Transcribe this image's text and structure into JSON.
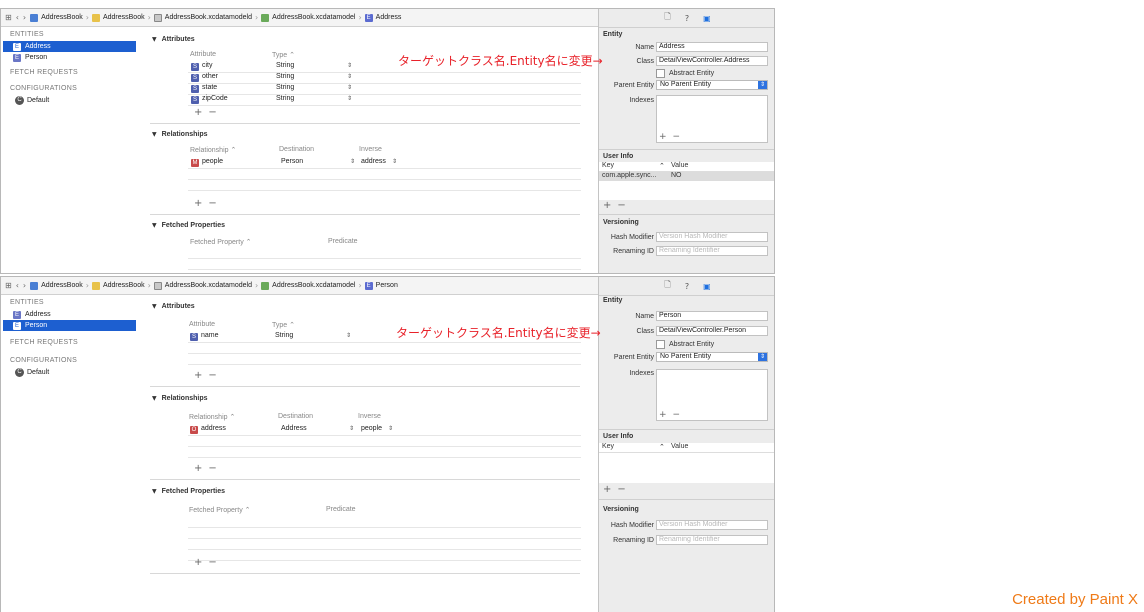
{
  "panels": [
    {
      "breadcrumb": [
        "AddressBook",
        "AddressBook",
        "AddressBook.xcdatamodeld",
        "AddressBook.xcdatamodel",
        "Address"
      ],
      "sidebar": {
        "entities_header": "ENTITIES",
        "entities": [
          "Address",
          "Person"
        ],
        "selected": "Address",
        "fetch_header": "FETCH REQUESTS",
        "config_header": "CONFIGURATIONS",
        "configs": [
          "Default"
        ]
      },
      "attributes": {
        "title": "Attributes",
        "col_attribute": "Attribute",
        "col_type": "Type",
        "rows": [
          {
            "name": "city",
            "type": "String"
          },
          {
            "name": "other",
            "type": "String"
          },
          {
            "name": "state",
            "type": "String"
          },
          {
            "name": "zipCode",
            "type": "String"
          }
        ]
      },
      "relationships": {
        "title": "Relationships",
        "col_relationship": "Relationship",
        "col_destination": "Destination",
        "col_inverse": "Inverse",
        "rows": [
          {
            "badge": "M",
            "name": "people",
            "destination": "Person",
            "inverse": "address"
          }
        ]
      },
      "fetched": {
        "title": "Fetched Properties",
        "col_property": "Fetched Property",
        "col_predicate": "Predicate"
      },
      "inspector": {
        "section": "Entity",
        "name_label": "Name",
        "name_value": "Address",
        "class_label": "Class",
        "class_value": "DetailViewController.Address",
        "abstract_label": "Abstract Entity",
        "parent_label": "Parent Entity",
        "parent_value": "No Parent Entity",
        "indexes_label": "Indexes",
        "user_info_header": "User Info",
        "key_col": "Key",
        "value_col": "Value",
        "user_info_rows": [
          {
            "key": "com.apple.sync...",
            "value": "NO"
          }
        ],
        "versioning_header": "Versioning",
        "hash_label": "Hash Modifier",
        "hash_placeholder": "Version Hash Modifier",
        "renaming_label": "Renaming ID",
        "renaming_placeholder": "Renaming Identifier"
      },
      "annotation": "ターゲットクラス名.Entity名に変更→"
    },
    {
      "breadcrumb": [
        "AddressBook",
        "AddressBook",
        "AddressBook.xcdatamodeld",
        "AddressBook.xcdatamodel",
        "Person"
      ],
      "sidebar": {
        "entities_header": "ENTITIES",
        "entities": [
          "Address",
          "Person"
        ],
        "selected": "Person",
        "fetch_header": "FETCH REQUESTS",
        "config_header": "CONFIGURATIONS",
        "configs": [
          "Default"
        ]
      },
      "attributes": {
        "title": "Attributes",
        "col_attribute": "Attribute",
        "col_type": "Type",
        "rows": [
          {
            "name": "name",
            "type": "String"
          }
        ]
      },
      "relationships": {
        "title": "Relationships",
        "col_relationship": "Relationship",
        "col_destination": "Destination",
        "col_inverse": "Inverse",
        "rows": [
          {
            "badge": "O",
            "name": "address",
            "destination": "Address",
            "inverse": "people"
          }
        ]
      },
      "fetched": {
        "title": "Fetched Properties",
        "col_property": "Fetched Property",
        "col_predicate": "Predicate"
      },
      "inspector": {
        "section": "Entity",
        "name_label": "Name",
        "name_value": "Person",
        "class_label": "Class",
        "class_value": "DetailViewController.Person",
        "abstract_label": "Abstract Entity",
        "parent_label": "Parent Entity",
        "parent_value": "No Parent Entity",
        "indexes_label": "Indexes",
        "user_info_header": "User Info",
        "key_col": "Key",
        "value_col": "Value",
        "user_info_rows": [],
        "versioning_header": "Versioning",
        "hash_label": "Hash Modifier",
        "hash_placeholder": "Version Hash Modifier",
        "renaming_label": "Renaming ID",
        "renaming_placeholder": "Renaming Identifier"
      },
      "annotation": "ターゲットクラス名.Entity名に変更→"
    }
  ],
  "credit": "Created by Paint X",
  "colors": {
    "selection": "#1d5fd0",
    "annotation": "#e8222a",
    "credit": "#ef7a17"
  }
}
